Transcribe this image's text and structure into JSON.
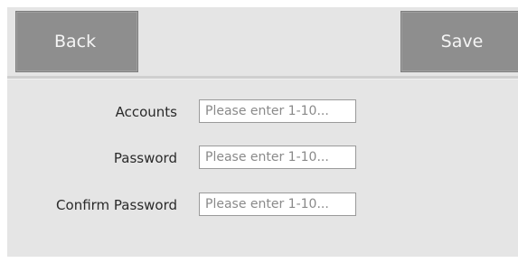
{
  "toolbar": {
    "back_label": "Back",
    "save_label": "Save"
  },
  "form": {
    "fields": [
      {
        "label": "Accounts",
        "value": "",
        "placeholder": "Please enter 1-10..."
      },
      {
        "label": "Password",
        "value": "",
        "placeholder": "Please enter 1-10..."
      },
      {
        "label": "Confirm Password",
        "value": "",
        "placeholder": "Please enter 1-10..."
      }
    ]
  },
  "colors": {
    "background": "#e5e5e5",
    "button": "#8e8e8e",
    "button_text": "#f5f5f5"
  }
}
